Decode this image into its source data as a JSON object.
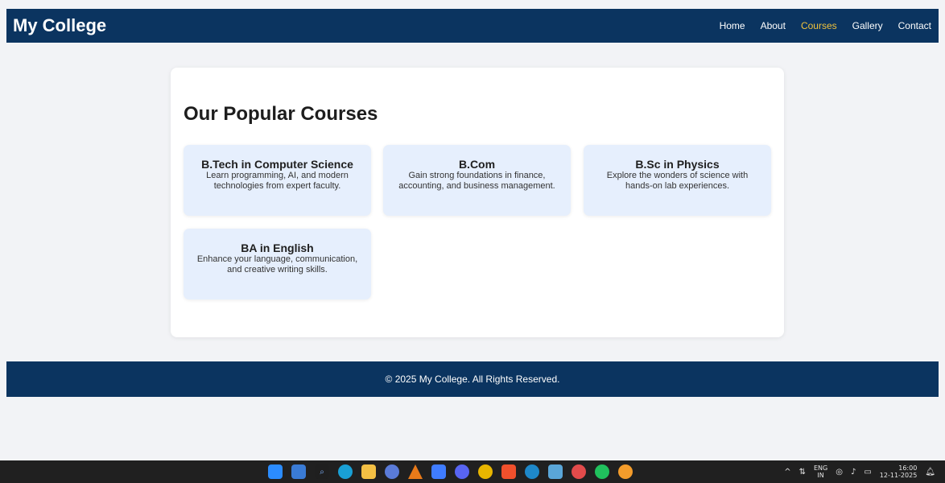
{
  "header": {
    "brand": "My College",
    "nav": [
      "Home",
      "About",
      "Courses",
      "Gallery",
      "Contact"
    ],
    "active_nav": "Courses",
    "colors": {
      "bar": "#0b3460",
      "active": "#f0c23b"
    }
  },
  "main": {
    "title": "Our Popular Courses",
    "courses": [
      {
        "title": "B.Tech in Computer Science",
        "desc": "Learn programming, AI, and modern technologies from expert faculty."
      },
      {
        "title": "B.Com",
        "desc": "Gain strong foundations in finance, accounting, and business management."
      },
      {
        "title": "B.Sc in Physics",
        "desc": "Explore the wonders of science with hands-on lab experiences."
      },
      {
        "title": "BA in English",
        "desc": "Enhance your language, communication, and creative writing skills."
      }
    ]
  },
  "footer": {
    "text": "© 2025 My College. All Rights Reserved."
  },
  "taskbar": {
    "apps": [
      "windows-start-icon",
      "calendar-widget-icon",
      "search-icon",
      "edge-icon",
      "file-explorer-icon",
      "copilot-icon",
      "vlc-icon",
      "vscode-icon",
      "discord-icon",
      "chrome-icon",
      "brave-icon",
      "edge-dev-icon",
      "security-icon",
      "chrome-canary-icon",
      "whatsapp-icon",
      "chrome-beta-icon"
    ],
    "tray": {
      "lang_top": "ENG",
      "lang_bottom": "IN",
      "time": "16:00",
      "date": "12-11-2025"
    }
  }
}
